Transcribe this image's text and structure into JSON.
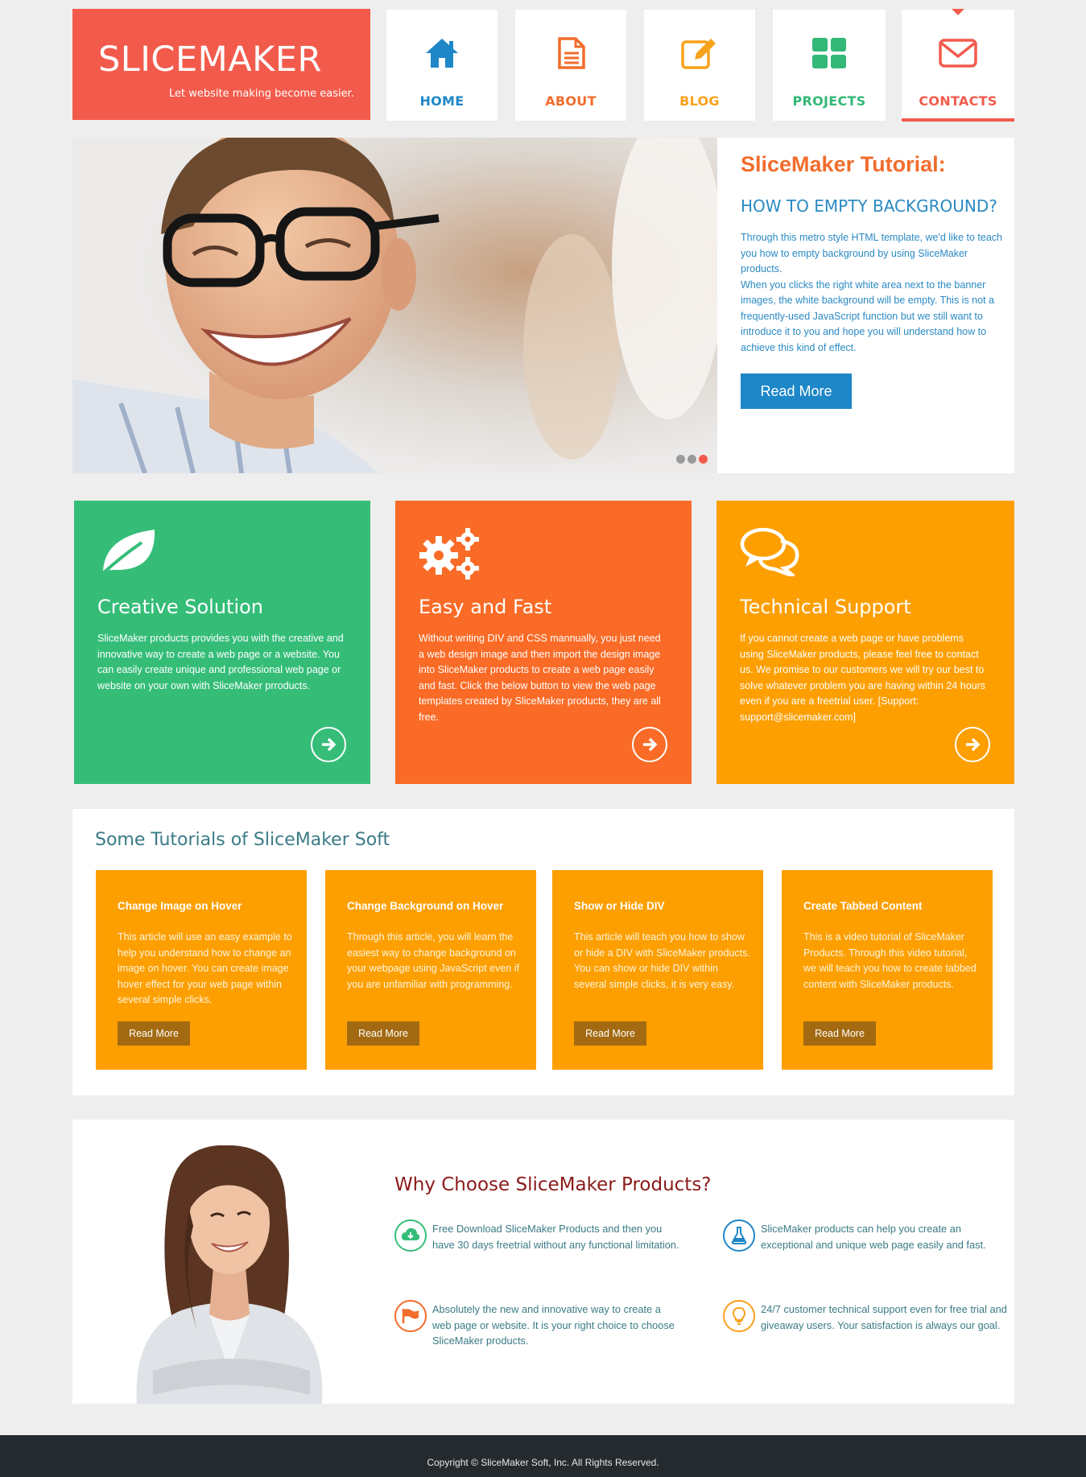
{
  "brand": {
    "title": "SLICEMAKER",
    "tagline": "Let website making become easier.",
    "color": "#f25b4c"
  },
  "nav": [
    {
      "label": "HOME",
      "icon": "home-icon",
      "color": "#1f87c7"
    },
    {
      "label": "ABOUT",
      "icon": "document-icon",
      "color": "#f26c2c"
    },
    {
      "label": "BLOG",
      "icon": "edit-icon",
      "color": "#f8a11b"
    },
    {
      "label": "PROJECTS",
      "icon": "grid-icon",
      "color": "#33b877"
    },
    {
      "label": "CONTACTS",
      "icon": "mail-icon",
      "color": "#f25b4c",
      "active": true
    }
  ],
  "banner": {
    "title": "SliceMaker Tutorial:",
    "subtitle": "HOW TO EMPTY BACKGROUND?",
    "body": "Through this metro style HTML template, we'd like to teach you how to empty background by using SliceMaker products.\nWhen you clicks the right white area next to the banner images, the white background will be empty. This is not a frequently-used JavaScript function but we still want to introduce it to you and hope you will understand how to achieve this kind of effect.",
    "button": "Read More",
    "slides": 3,
    "active_slide": 3
  },
  "features": [
    {
      "title": "Creative Solution",
      "icon": "leaf-icon",
      "color": "#35bd78",
      "body": "SliceMaker products provides you with the creative and innovative way to create a web page or a website. You can easily create unique and professional web page or website on your own with SliceMaker prroducts."
    },
    {
      "title": "Easy and Fast",
      "icon": "gears-icon",
      "color": "#f96b26",
      "body": "Without writing DIV and CSS mannually, you just need a web design image and then import the design image into SliceMaker products to create a web page easily and fast. Click the below button to view the web page templates created by SliceMaker products, they are all free."
    },
    {
      "title": "Technical Support",
      "icon": "chat-icon",
      "color": "#fd9f00",
      "body": "If you cannot create a web page or have problems using SliceMaker products, please feel free to contact us. We promise to our customers we will try our best to solve whatever problem you are having within 24 hours even if you are a freetrial user. [Support: support@slicemaker.com]"
    }
  ],
  "tutorials": {
    "heading": "Some Tutorials of SliceMaker Soft",
    "cards": [
      {
        "title": "Change Image on Hover",
        "body": "This article will use an easy example to help you understand how to change an image on hover. You can create image hover effect for your web page within several simple clicks.",
        "button": "Read More"
      },
      {
        "title": "Change Background on Hover",
        "body": "Through this article, you will learn the easiest way to change background on your webpage using JavaScript even if you are unfamiliar with programming.",
        "button": "Read More"
      },
      {
        "title": "Show or Hide DIV",
        "body": "This article will teach you how to show or hide a DIV with SliceMaker products. You can show or hide DIV within several simple clicks, it is very easy.",
        "button": "Read More"
      },
      {
        "title": "Create Tabbed Content",
        "body": "This is a video tutorial of SliceMaker Products. Through this video tutorial, we will teach you how to create tabbed content with SliceMaker products.",
        "button": "Read More"
      }
    ]
  },
  "why": {
    "heading": "Why Choose SliceMaker Products?",
    "items": [
      {
        "icon": "cloud-download-icon",
        "color": "#35bd78",
        "text": "Free Download SliceMaker Products and then you have 30 days freetrial without any functional limitation."
      },
      {
        "icon": "flask-icon",
        "color": "#1f87c7",
        "text": "SliceMaker products can help you create an exceptional and unique web page easily and fast."
      },
      {
        "icon": "flag-icon",
        "color": "#f26c2c",
        "text": "Absolutely the new and innovative way to create a web page or website. It is your right choice to choose SliceMaker products."
      },
      {
        "icon": "lightbulb-icon",
        "color": "#f8a11b",
        "text": "24/7 customer technical support even for free trial and giveaway users. Your satisfaction is always our goal."
      }
    ]
  },
  "footer": {
    "copyright": "Copyright © SliceMaker Soft, Inc. All Rights Reserved."
  }
}
